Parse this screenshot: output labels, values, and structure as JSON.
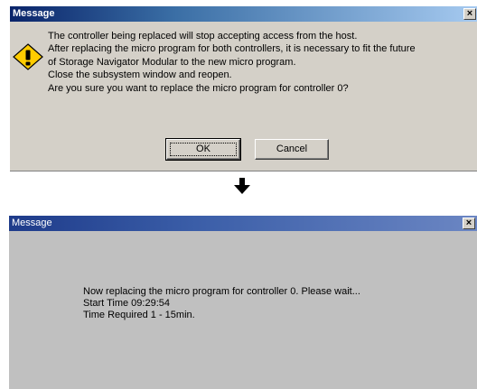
{
  "confirm_dialog": {
    "title": "Message",
    "close_label": "×",
    "icon": "warning-icon",
    "lines": [
      "The controller being replaced will stop accepting access from the host.",
      "After replacing the micro program for both controllers, it is necessary to fit the future",
      "of Storage Navigator Modular to the new micro program.",
      "Close the subsystem window and reopen.",
      "Are you sure you want to replace the micro program for controller 0?"
    ],
    "ok_label": "OK",
    "cancel_label": "Cancel"
  },
  "arrow_icon": "down-arrow-icon",
  "progress_dialog": {
    "title": "Message",
    "close_label": "×",
    "lines": [
      "Now replacing the micro program for controller 0. Please wait...",
      "Start Time 09:29:54",
      "Time Required 1 - 15min."
    ]
  },
  "colors": {
    "dialog_face": "#d4d0c8",
    "title_active": "#0a246a",
    "warning_yellow": "#ffcc00"
  }
}
